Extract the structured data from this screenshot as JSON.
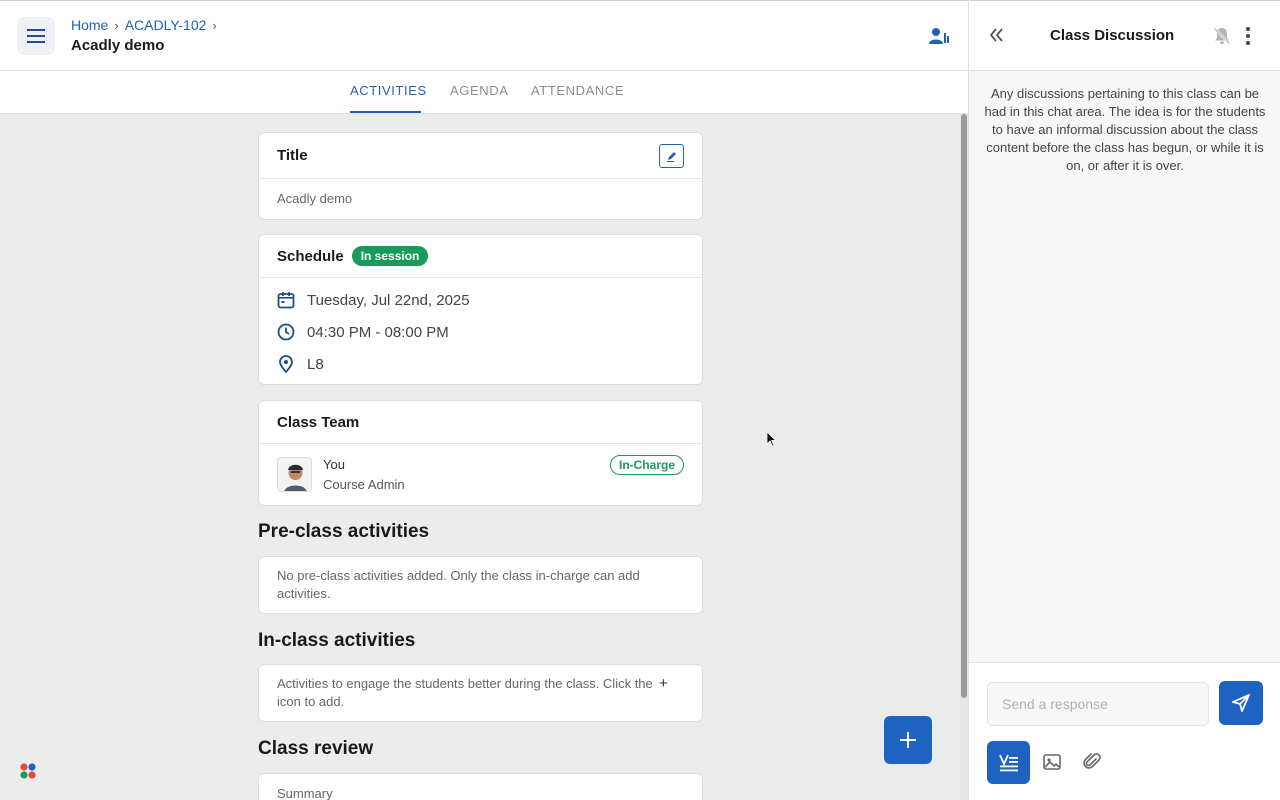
{
  "header": {
    "breadcrumb": [
      "Home",
      "ACADLY-102"
    ],
    "title": "Acadly demo"
  },
  "tabs": [
    "ACTIVITIES",
    "AGENDA",
    "ATTENDANCE"
  ],
  "active_tab": "ACTIVITIES",
  "title_card": {
    "heading": "Title",
    "value": "Acadly demo"
  },
  "schedule": {
    "heading": "Schedule",
    "status": "In session",
    "date": "Tuesday, Jul 22nd, 2025",
    "time": "04:30 PM - 08:00 PM",
    "location": "L8"
  },
  "team": {
    "heading": "Class Team",
    "member_name": "You",
    "member_role": "Course Admin",
    "badge": "In-Charge"
  },
  "pre_class": {
    "heading": "Pre-class activities",
    "text": "No pre-class activities added. Only the class in-charge can add activities."
  },
  "in_class": {
    "heading": "In-class activities",
    "text_before": "Activities to engage the students better during the class. Click the",
    "text_after": "icon to add."
  },
  "review": {
    "heading": "Class review",
    "summary_label": "Summary"
  },
  "panel": {
    "title": "Class Discussion",
    "description": "Any discussions pertaining to this class can be had in this chat area. The idea is for the students to have an informal discussion about the class content before the class has begun, or while it is on, or after it is over.",
    "input_placeholder": "Send a response"
  },
  "colors": {
    "primary": "#1e63c2",
    "success": "#1a9b5a",
    "background": "#ececec"
  }
}
